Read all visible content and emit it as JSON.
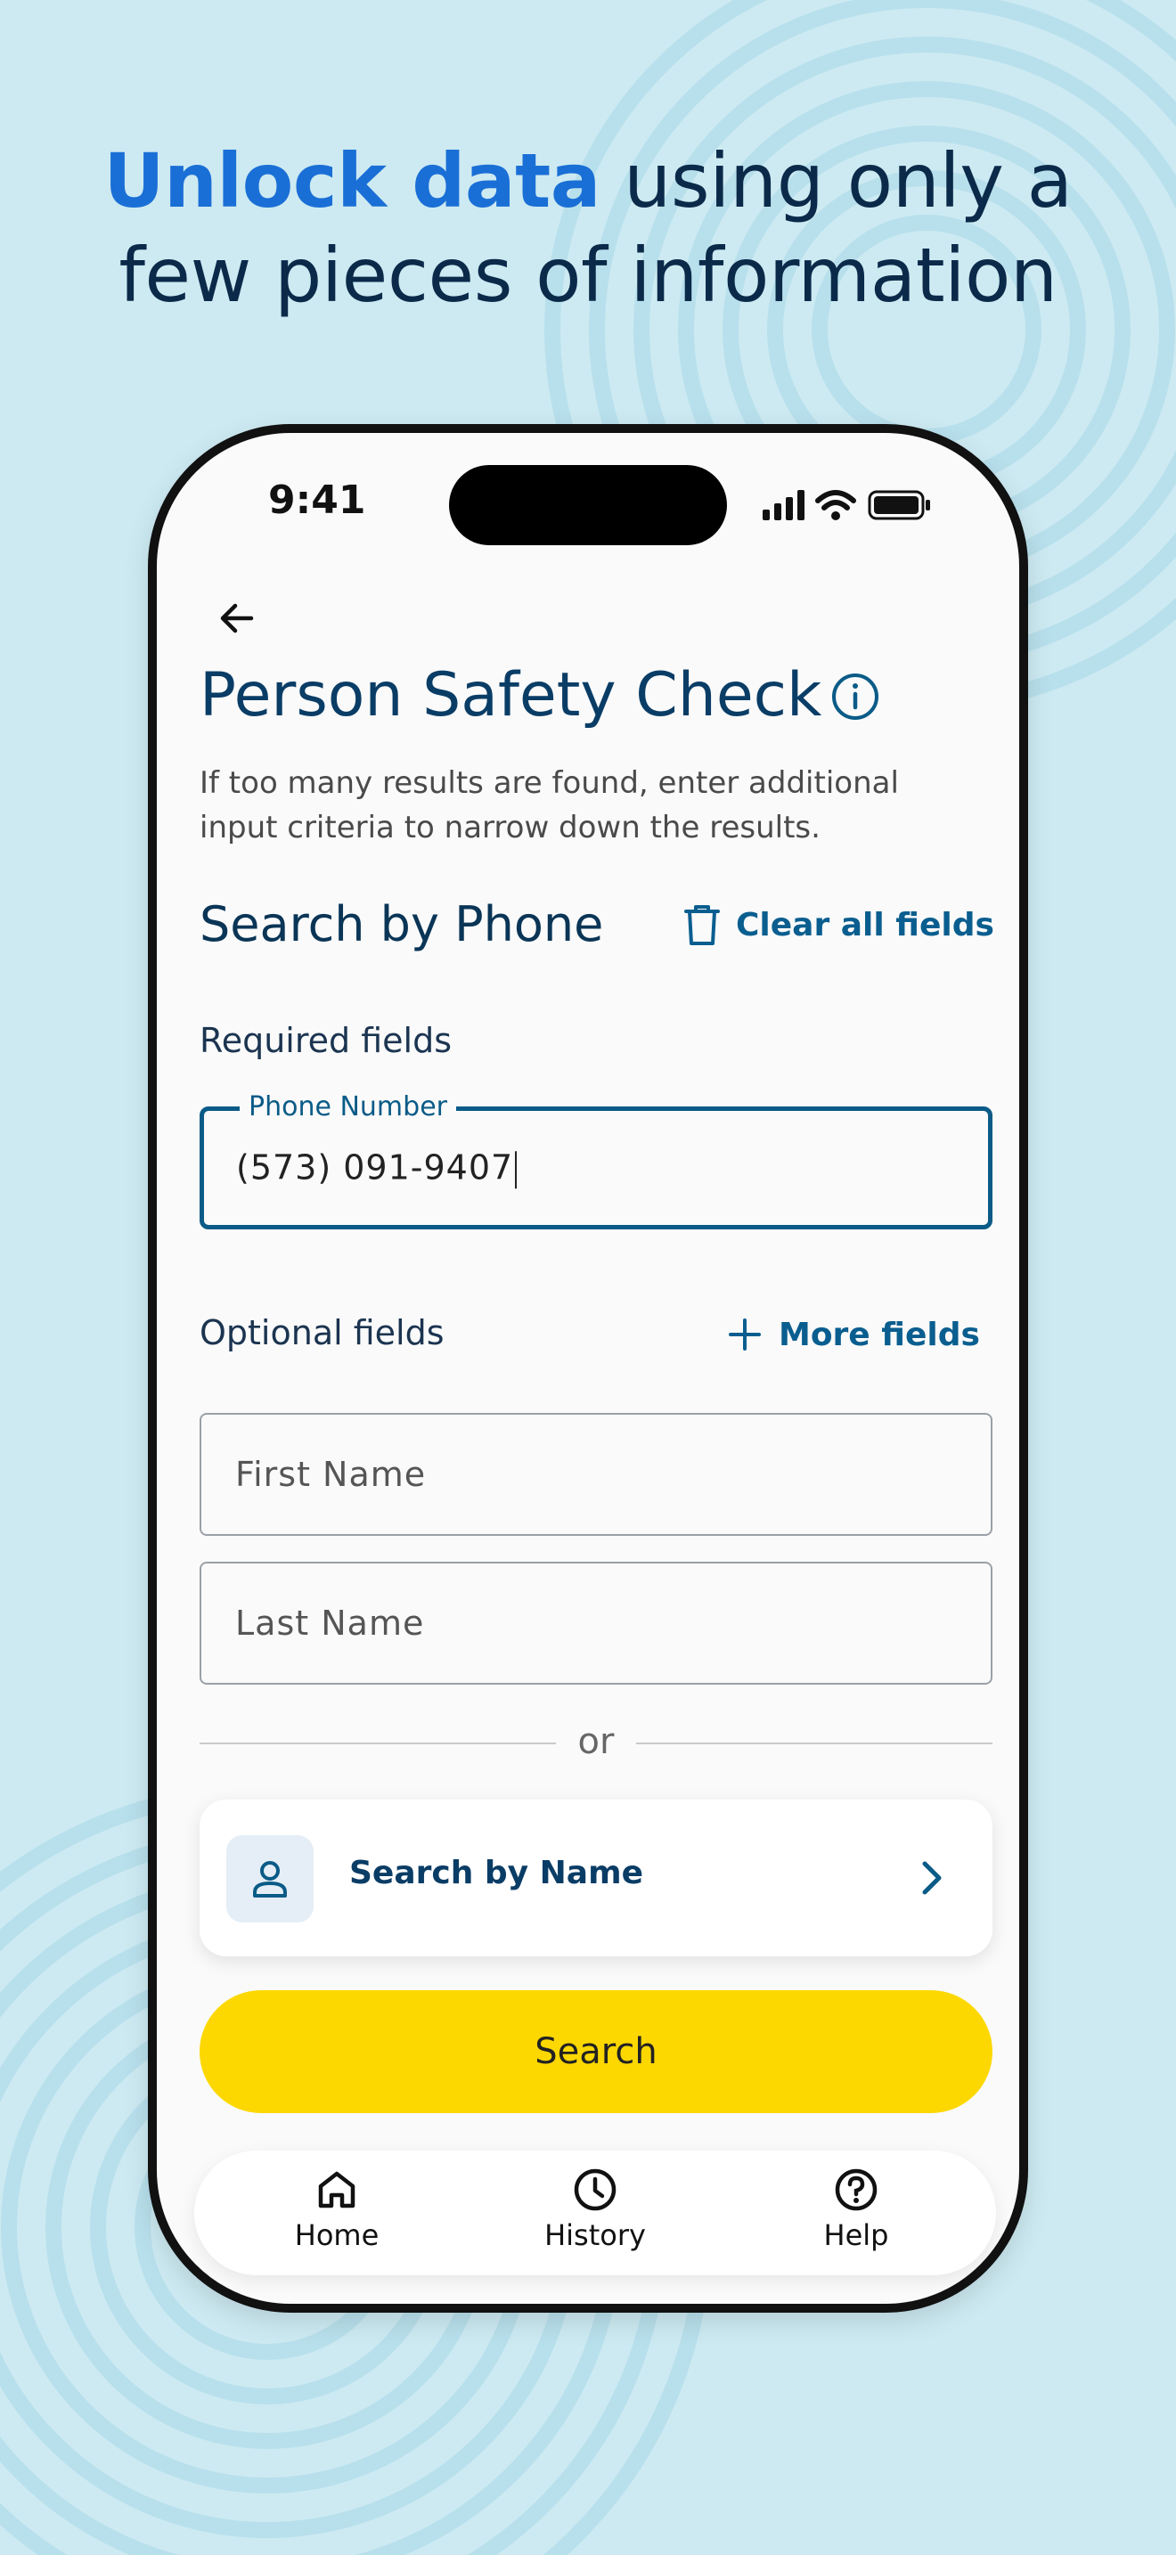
{
  "headline": {
    "accent": "Unlock data",
    "rest_line1": "using only a",
    "line2": "few pieces of information"
  },
  "status_bar": {
    "time": "9:41"
  },
  "page": {
    "title": "Person Safety Check",
    "subtitle": "If too many results are found, enter additional input criteria to narrow down the results."
  },
  "section": {
    "title": "Search by Phone",
    "clear_label": "Clear all fields"
  },
  "required": {
    "label": "Required fields",
    "phone": {
      "label": "Phone Number",
      "value": "(573) 091-9407"
    }
  },
  "optional": {
    "label": "Optional fields",
    "more_label": "More fields",
    "first_name_placeholder": "First Name",
    "last_name_placeholder": "Last Name"
  },
  "divider_text": "or",
  "name_card": {
    "label": "Search by Name"
  },
  "search_button": "Search",
  "tabs": [
    {
      "label": "Home",
      "icon": "home-icon"
    },
    {
      "label": "History",
      "icon": "clock-icon"
    },
    {
      "label": "Help",
      "icon": "help-icon"
    }
  ],
  "colors": {
    "accent": "#1a6fd6",
    "primary": "#0a5b87",
    "button": "#fcd800",
    "background": "#cdeaf2"
  }
}
